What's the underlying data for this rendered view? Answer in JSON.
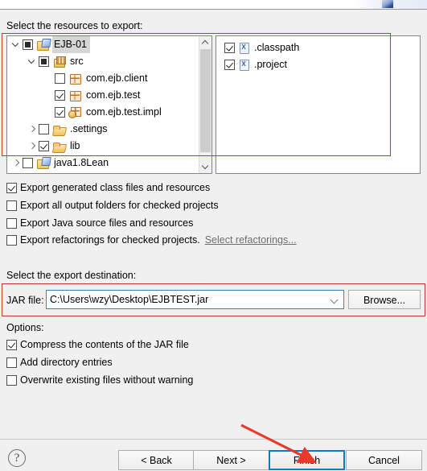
{
  "dialog": {
    "resources_label": "Select the resources to export:",
    "destination_label": "Select the export destination:",
    "options_label": "Options:"
  },
  "tree": {
    "items": [
      {
        "indent": 0,
        "twisty": "down",
        "check": "grayed",
        "icon": "project-icon",
        "label": "EJB-01",
        "selected": true
      },
      {
        "indent": 1,
        "twisty": "down",
        "check": "grayed",
        "icon": "source-folder-icon",
        "label": "src",
        "selected": false
      },
      {
        "indent": 2,
        "twisty": "none",
        "check": "unchecked",
        "icon": "package-icon",
        "label": "com.ejb.client",
        "selected": false
      },
      {
        "indent": 2,
        "twisty": "none",
        "check": "checked",
        "icon": "package-icon",
        "label": "com.ejb.test",
        "selected": false
      },
      {
        "indent": 2,
        "twisty": "none",
        "check": "checked",
        "icon": "package-impl-icon",
        "label": "com.ejb.test.impl",
        "selected": false
      },
      {
        "indent": 1,
        "twisty": "right",
        "check": "unchecked",
        "icon": "folder-icon",
        "label": ".settings",
        "selected": false
      },
      {
        "indent": 1,
        "twisty": "right",
        "check": "checked",
        "icon": "folder-icon",
        "label": "lib",
        "selected": false
      },
      {
        "indent": 0,
        "twisty": "right",
        "check": "unchecked",
        "icon": "project-icon",
        "label": "java1.8Lean",
        "selected": false
      }
    ]
  },
  "files": {
    "items": [
      {
        "check": "checked",
        "icon": "xml-file-icon",
        "label": ".classpath"
      },
      {
        "check": "checked",
        "icon": "xml-file-icon",
        "label": ".project"
      }
    ]
  },
  "export_options": [
    {
      "check": "checked",
      "label": "Export generated class files and resources",
      "link": ""
    },
    {
      "check": "unchecked",
      "label": "Export all output folders for checked projects",
      "link": ""
    },
    {
      "check": "unchecked",
      "label": "Export Java source files and resources",
      "link": ""
    },
    {
      "check": "unchecked",
      "label": "Export refactorings for checked projects.",
      "link": "Select refactorings..."
    }
  ],
  "destination": {
    "jar_label": "JAR file:",
    "jar_value": "C:\\Users\\wzy\\Desktop\\EJBTEST.jar",
    "browse_label": "Browse..."
  },
  "jar_options": [
    {
      "check": "checked",
      "label": "Compress the contents of the JAR file"
    },
    {
      "check": "unchecked",
      "label": "Add directory entries"
    },
    {
      "check": "unchecked",
      "label": "Overwrite existing files without warning"
    }
  ],
  "buttons": {
    "back": "< Back",
    "next": "Next >",
    "finish": "Finish",
    "cancel": "Cancel",
    "help": "?"
  },
  "annotations": {
    "accent_color": "#c0392b",
    "focus_color": "#0d7bc4"
  }
}
